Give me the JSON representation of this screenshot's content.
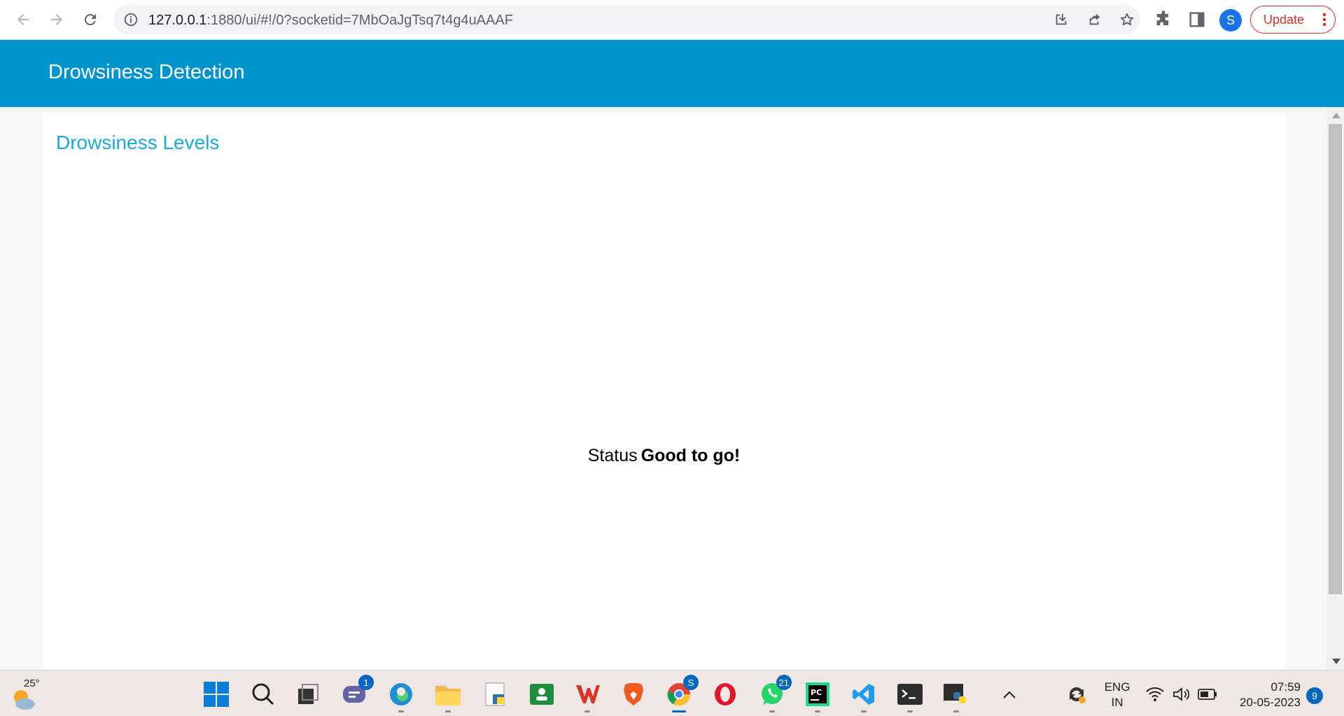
{
  "browser": {
    "url_host": "127.0.0.1",
    "url_rest": ":1880/ui/#!/0?socketid=7MbOaJgTsq7t4g4uAAAF",
    "profile_initial": "S",
    "update_label": "Update"
  },
  "dashboard": {
    "header_title": "Drowsiness Detection",
    "card_title": "Drowsiness Levels",
    "status_label": "Status",
    "status_value": "Good to go!"
  },
  "taskbar": {
    "weather_temp": "25°",
    "teams_badge": "1",
    "chrome_badge": "S",
    "whatsapp_badge": "21",
    "language_line1": "ENG",
    "language_line2": "IN",
    "time": "07:59",
    "date": "20-05-2023",
    "notification_count": "9"
  },
  "colors": {
    "header_blue": "#0094ce",
    "card_title_blue": "#1ba9e1",
    "update_red": "#d93025",
    "profile_blue": "#1a73e8"
  }
}
